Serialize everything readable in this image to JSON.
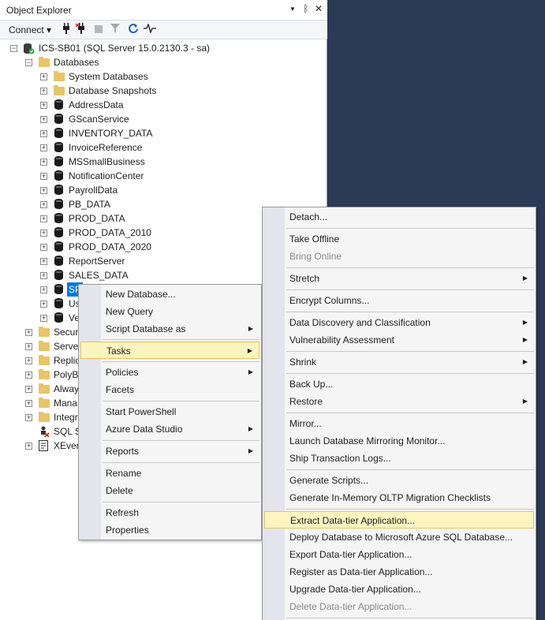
{
  "panel": {
    "title": "Object Explorer",
    "pin_glyph": "▼",
    "dock_glyph": "ᛒ",
    "close_glyph": "✕",
    "connect_label": "Connect ▾"
  },
  "tree": {
    "server": "ICS-SB01 (SQL Server 15.0.2130.3 - sa)",
    "databases": "Databases",
    "db_items": [
      {
        "label": "System Databases",
        "kind": "folder"
      },
      {
        "label": "Database Snapshots",
        "kind": "folder"
      },
      {
        "label": "AddressData",
        "kind": "db"
      },
      {
        "label": "GScanService",
        "kind": "db"
      },
      {
        "label": "INVENTORY_DATA",
        "kind": "db"
      },
      {
        "label": "InvoiceReference",
        "kind": "db"
      },
      {
        "label": "MSSmallBusiness",
        "kind": "db"
      },
      {
        "label": "NotificationCenter",
        "kind": "db"
      },
      {
        "label": "PayrollData",
        "kind": "db"
      },
      {
        "label": "PB_DATA",
        "kind": "db"
      },
      {
        "label": "PROD_DATA",
        "kind": "db"
      },
      {
        "label": "PROD_DATA_2010",
        "kind": "db"
      },
      {
        "label": "PROD_DATA_2020",
        "kind": "db"
      },
      {
        "label": "ReportServer",
        "kind": "db"
      },
      {
        "label": "SALES_DATA",
        "kind": "db"
      },
      {
        "label": "SP",
        "kind": "db"
      },
      {
        "label": "Us",
        "kind": "db"
      },
      {
        "label": "Ve",
        "kind": "db"
      }
    ],
    "server_items": [
      {
        "label": "Securi",
        "kind": "folder"
      },
      {
        "label": "Server",
        "kind": "folder"
      },
      {
        "label": "Replic",
        "kind": "folder"
      },
      {
        "label": "PolyB",
        "kind": "folder"
      },
      {
        "label": "Alway",
        "kind": "folder"
      },
      {
        "label": "Mana",
        "kind": "folder"
      },
      {
        "label": "Integr",
        "kind": "folder"
      },
      {
        "label": "SQL S",
        "kind": "agent"
      },
      {
        "label": "XEven",
        "kind": "xevent"
      }
    ]
  },
  "context_menu": {
    "new_database": "New Database...",
    "new_query": "New Query",
    "script_database_as": "Script Database as",
    "tasks": "Tasks",
    "policies": "Policies",
    "facets": "Facets",
    "start_powershell": "Start PowerShell",
    "azure_data_studio": "Azure Data Studio",
    "reports": "Reports",
    "rename": "Rename",
    "delete": "Delete",
    "refresh": "Refresh",
    "properties": "Properties"
  },
  "tasks_menu": {
    "detach": "Detach...",
    "take_offline": "Take Offline",
    "bring_online": "Bring Online",
    "stretch": "Stretch",
    "encrypt_columns": "Encrypt Columns...",
    "data_discovery": "Data Discovery and Classification",
    "vulnerability": "Vulnerability Assessment",
    "shrink": "Shrink",
    "back_up": "Back Up...",
    "restore": "Restore",
    "mirror": "Mirror...",
    "launch_mirroring": "Launch Database Mirroring Monitor...",
    "ship_logs": "Ship Transaction Logs...",
    "generate_scripts": "Generate Scripts...",
    "generate_inmemory": "Generate In-Memory OLTP Migration Checklists",
    "extract_dac": "Extract Data-tier Application...",
    "deploy_azure": "Deploy Database to Microsoft Azure SQL Database...",
    "export_dac": "Export Data-tier Application...",
    "register_dac": "Register as Data-tier Application...",
    "upgrade_dac": "Upgrade Data-tier Application...",
    "delete_dac": "Delete Data-tier Application..."
  },
  "arrow_glyph": "▶"
}
